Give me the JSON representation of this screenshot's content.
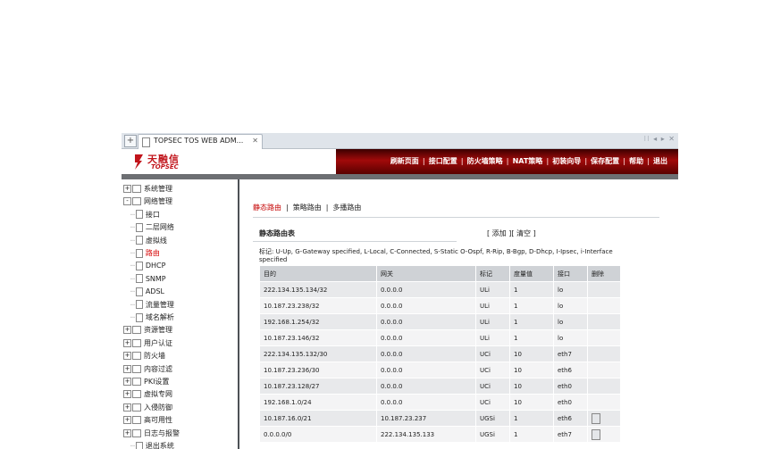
{
  "browser": {
    "tab_title": "TOPSEC TOS WEB ADM...",
    "new_tab_icon": "plus-icon",
    "close_icon": "close-icon",
    "tab_controls": "⁝⁝ ◂ ▸ ✕"
  },
  "header": {
    "logo_cn": "天融信",
    "logo_en": "TOPSEC",
    "nav": [
      "刷新页面",
      "接口配置",
      "防火墙策略",
      "NAT策略",
      "初装向导",
      "保存配置",
      "帮助",
      "退出"
    ],
    "nav_separator": "|"
  },
  "sidebar": {
    "items": [
      {
        "label": "系统管理",
        "level": 0,
        "expander": "+",
        "icon": "folder-icon"
      },
      {
        "label": "网络管理",
        "level": 0,
        "expander": "-",
        "icon": "folder-icon"
      },
      {
        "label": "接口",
        "level": 1,
        "icon": "page-icon"
      },
      {
        "label": "二层网络",
        "level": 1,
        "icon": "page-icon"
      },
      {
        "label": "虚拟线",
        "level": 1,
        "icon": "page-icon"
      },
      {
        "label": "路由",
        "level": 1,
        "icon": "page-icon",
        "selected": true
      },
      {
        "label": "DHCP",
        "level": 1,
        "icon": "page-icon"
      },
      {
        "label": "SNMP",
        "level": 1,
        "icon": "page-icon"
      },
      {
        "label": "ADSL",
        "level": 1,
        "icon": "page-icon"
      },
      {
        "label": "流量管理",
        "level": 1,
        "icon": "page-icon"
      },
      {
        "label": "域名解析",
        "level": 1,
        "icon": "page-icon"
      },
      {
        "label": "资源管理",
        "level": 0,
        "expander": "+",
        "icon": "folder-icon"
      },
      {
        "label": "用户认证",
        "level": 0,
        "expander": "+",
        "icon": "folder-icon"
      },
      {
        "label": "防火墙",
        "level": 0,
        "expander": "+",
        "icon": "folder-icon"
      },
      {
        "label": "内容过滤",
        "level": 0,
        "expander": "+",
        "icon": "folder-icon"
      },
      {
        "label": "PKI设置",
        "level": 0,
        "expander": "+",
        "icon": "folder-icon"
      },
      {
        "label": "虚拟专网",
        "level": 0,
        "expander": "+",
        "icon": "folder-icon"
      },
      {
        "label": "入侵防御",
        "level": 0,
        "expander": "+",
        "icon": "folder-icon"
      },
      {
        "label": "高可用性",
        "level": 0,
        "expander": "+",
        "icon": "folder-icon"
      },
      {
        "label": "日志与报警",
        "level": 0,
        "expander": "+",
        "icon": "folder-icon"
      },
      {
        "label": "退出系统",
        "level": 1,
        "icon": "page-icon"
      }
    ]
  },
  "main": {
    "subtabs": [
      "静态路由",
      "策略路由",
      "多播路由"
    ],
    "subtab_separator": "|",
    "table_title": "静态路由表",
    "actions": {
      "open": "[",
      "add": "添加",
      "mid": "][",
      "clear": "清空",
      "close": "]"
    },
    "legend": "标记: U-Up, G-Gateway specified, L-Local, C-Connected, S-Static O-Ospf, R-Rip, B-Bgp, D-Dhcp, I-Ipsec, i-Interface specified",
    "columns": [
      "目的",
      "网关",
      "标记",
      "度量值",
      "接口",
      "删除"
    ],
    "rows": [
      {
        "dest": "222.134.135.134/32",
        "gateway": "0.0.0.0",
        "flag": "ULi",
        "metric": "1",
        "iface": "lo",
        "del": false
      },
      {
        "dest": "10.187.23.238/32",
        "gateway": "0.0.0.0",
        "flag": "ULi",
        "metric": "1",
        "iface": "lo",
        "del": false
      },
      {
        "dest": "192.168.1.254/32",
        "gateway": "0.0.0.0",
        "flag": "ULi",
        "metric": "1",
        "iface": "lo",
        "del": false
      },
      {
        "dest": "10.187.23.146/32",
        "gateway": "0.0.0.0",
        "flag": "ULi",
        "metric": "1",
        "iface": "lo",
        "del": false
      },
      {
        "dest": "222.134.135.132/30",
        "gateway": "0.0.0.0",
        "flag": "UCi",
        "metric": "10",
        "iface": "eth7",
        "del": false
      },
      {
        "dest": "10.187.23.236/30",
        "gateway": "0.0.0.0",
        "flag": "UCi",
        "metric": "10",
        "iface": "eth6",
        "del": false
      },
      {
        "dest": "10.187.23.128/27",
        "gateway": "0.0.0.0",
        "flag": "UCi",
        "metric": "10",
        "iface": "eth0",
        "del": false
      },
      {
        "dest": "192.168.1.0/24",
        "gateway": "0.0.0.0",
        "flag": "UCi",
        "metric": "10",
        "iface": "eth0",
        "del": false
      },
      {
        "dest": "10.187.16.0/21",
        "gateway": "10.187.23.237",
        "flag": "UGSi",
        "metric": "1",
        "iface": "eth6",
        "del": true
      },
      {
        "dest": "0.0.0.0/0",
        "gateway": "222.134.135.133",
        "flag": "UGSi",
        "metric": "1",
        "iface": "eth7",
        "del": true
      }
    ]
  },
  "colors": {
    "accent": "#c1141b",
    "banner": "#a10a0a",
    "selected": "#d60000"
  }
}
